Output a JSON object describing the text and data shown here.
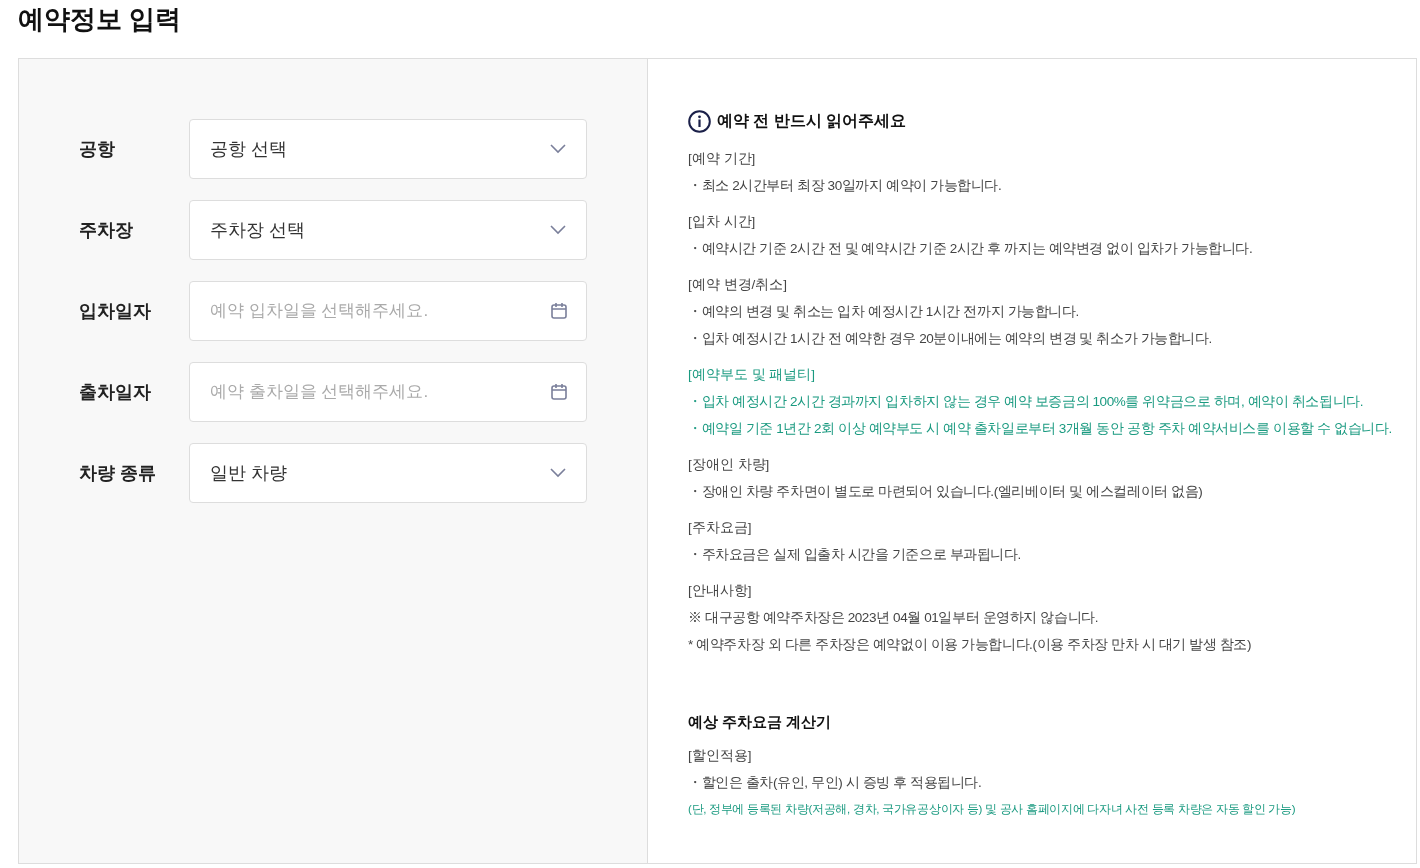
{
  "page_title": "예약정보 입력",
  "form": [
    {
      "label": "공항",
      "kind": "select",
      "value": "공항 선택"
    },
    {
      "label": "주차장",
      "kind": "select",
      "value": "주차장 선택"
    },
    {
      "label": "입차일자",
      "kind": "date",
      "placeholder": "예약 입차일을 선택해주세요."
    },
    {
      "label": "출차일자",
      "kind": "date",
      "placeholder": "예약 출차일을 선택해주세요."
    },
    {
      "label": "차량 종류",
      "kind": "select",
      "value": "일반 차량"
    }
  ],
  "notice": {
    "title": "예약 전 반드시 읽어주세요",
    "sections": [
      {
        "heading": "[예약 기간]",
        "highlight": false,
        "lines": [
          {
            "text": "・최소 2시간부터 최장 30일까지 예약이 가능합니다.",
            "kind": "plain"
          }
        ]
      },
      {
        "heading": "[입차 시간]",
        "highlight": false,
        "lines": [
          {
            "text": "・예약시간 기준 2시간 전 및 예약시간 기준 2시간 후 까지는 예약변경 없이 입차가 가능합니다.",
            "kind": "plain"
          }
        ]
      },
      {
        "heading": "[예약 변경/취소]",
        "highlight": false,
        "lines": [
          {
            "text": "・예약의 변경 및 취소는 입차 예정시간 1시간 전까지 가능합니다.",
            "kind": "plain"
          },
          {
            "text": "・입차 예정시간 1시간 전 예약한 경우 20분이내에는 예약의 변경 및 취소가 가능합니다.",
            "kind": "plain"
          }
        ]
      },
      {
        "heading": "[예약부도 및 패널티]",
        "highlight": true,
        "lines": [
          {
            "text": "・입차 예정시간 2시간 경과까지 입차하지 않는 경우 예약 보증금의 100%를 위약금으로 하며, 예약이 취소됩니다.",
            "kind": "plain"
          },
          {
            "text": "・예약일 기준 1년간 2회 이상 예약부도 시 예약 출차일로부터 3개월 동안 공항 주차 예약서비스를 이용할 수 없습니다.",
            "kind": "plain"
          }
        ]
      },
      {
        "heading": "[장애인 차량]",
        "highlight": false,
        "lines": [
          {
            "text": "・장애인 차량 주차면이 별도로 마련되어 있습니다.(엘리베이터 및 에스컬레이터 없음)",
            "kind": "plain"
          }
        ]
      },
      {
        "heading": "[주차요금]",
        "highlight": false,
        "lines": [
          {
            "text": "・주차요금은 실제 입출차 시간을 기준으로 부과됩니다.",
            "kind": "plain"
          }
        ]
      },
      {
        "heading": "[안내사항]",
        "highlight": false,
        "lines": [
          {
            "text": "※ 대구공항 예약주차장은 2023년 04월 01일부터 운영하지 않습니다.",
            "kind": "plain"
          },
          {
            "text": "* 예약주차장 외 다른 주차장은 예약없이 이용 가능합니다.(이용 주차장 만차 시 대기 발생 참조)",
            "kind": "plain"
          }
        ]
      }
    ]
  },
  "calculator": {
    "title": "예상 주차요금 계산기",
    "sections": [
      {
        "heading": "[할인적용]",
        "highlight": false,
        "lines": [
          {
            "text": "・할인은 출차(유인, 무인) 시 증빙 후 적용됩니다.",
            "kind": "plain"
          },
          {
            "text": "(단, 정부에 등록된 차량(저공해, 경차, 국가유공상이자 등) 및 공사 홈페이지에 다자녀 사전 등록 차량은 자동 할인 가능)",
            "kind": "fine"
          }
        ]
      }
    ]
  }
}
